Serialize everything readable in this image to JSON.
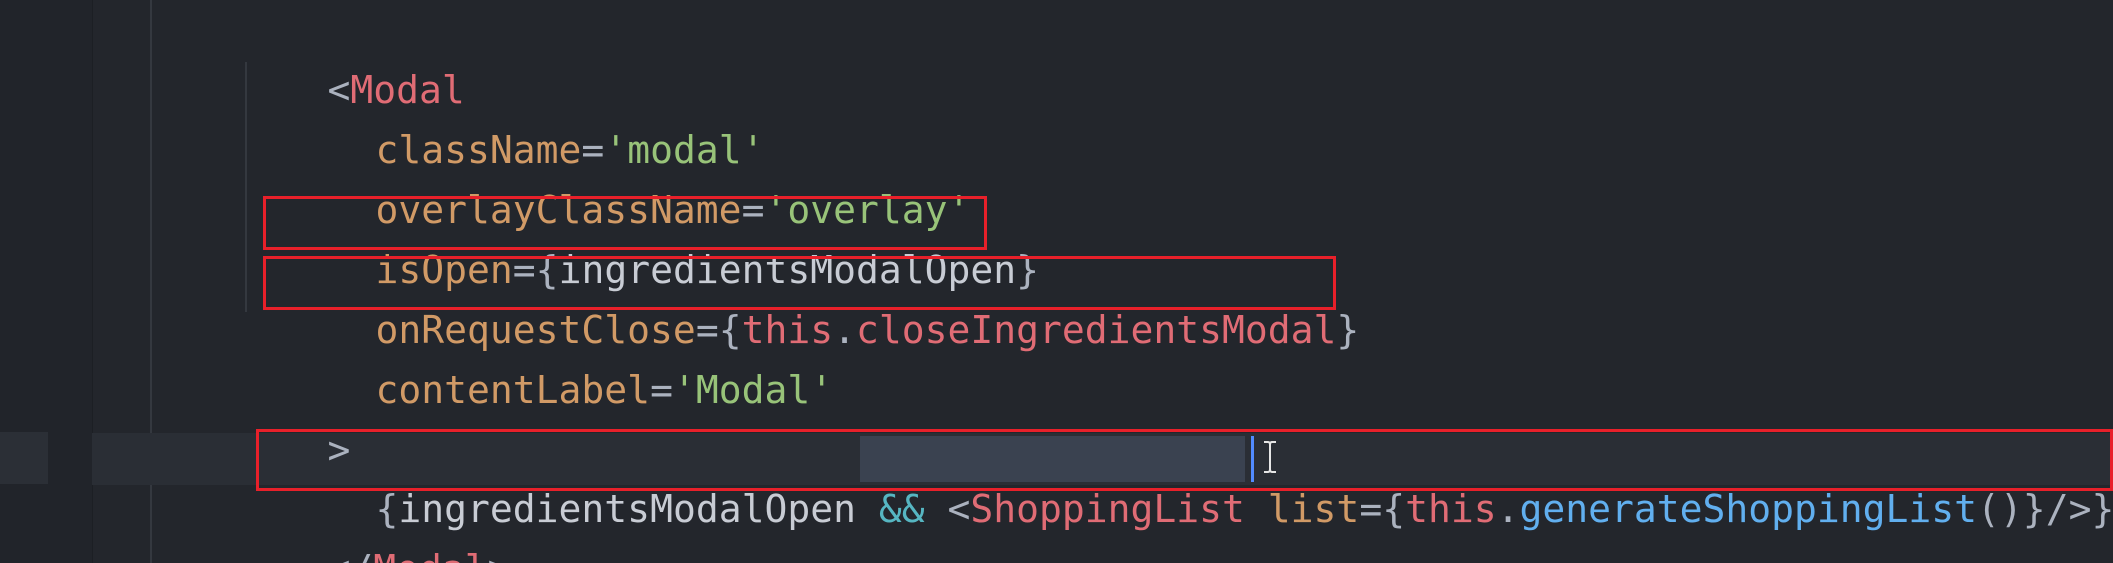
{
  "code": {
    "lines": [
      {
        "tokens": [
          "<",
          "Modal"
        ]
      },
      {
        "tokens": [
          "className",
          "=",
          "'modal'"
        ]
      },
      {
        "tokens": [
          "overlayClassName",
          "=",
          "'overlay'"
        ]
      },
      {
        "tokens": [
          "isOpen",
          "={",
          "ingredientsModalOpen",
          "}"
        ]
      },
      {
        "tokens": [
          "onRequestClose",
          "={",
          "this",
          ".",
          "closeIngredientsModal",
          "}"
        ]
      },
      {
        "tokens": [
          "contentLabel",
          "=",
          "'Modal'"
        ]
      },
      {
        "tokens": [
          ">"
        ]
      },
      {
        "tokens": [
          "{",
          "ingredientsModalOpen ",
          "&&",
          " <",
          "ShoppingList",
          " list",
          "={",
          "this",
          ".",
          "generateShoppingList",
          "()}",
          "/>}"
        ]
      },
      {
        "tokens": [
          "</",
          "Modal",
          ">"
        ]
      }
    ]
  },
  "colors": {
    "background": "#23262c",
    "tag": "#e06c75",
    "attribute": "#d19a66",
    "string": "#98c379",
    "function": "#61afef",
    "operator": "#56b6c2",
    "annotation_box": "#e8202a"
  }
}
